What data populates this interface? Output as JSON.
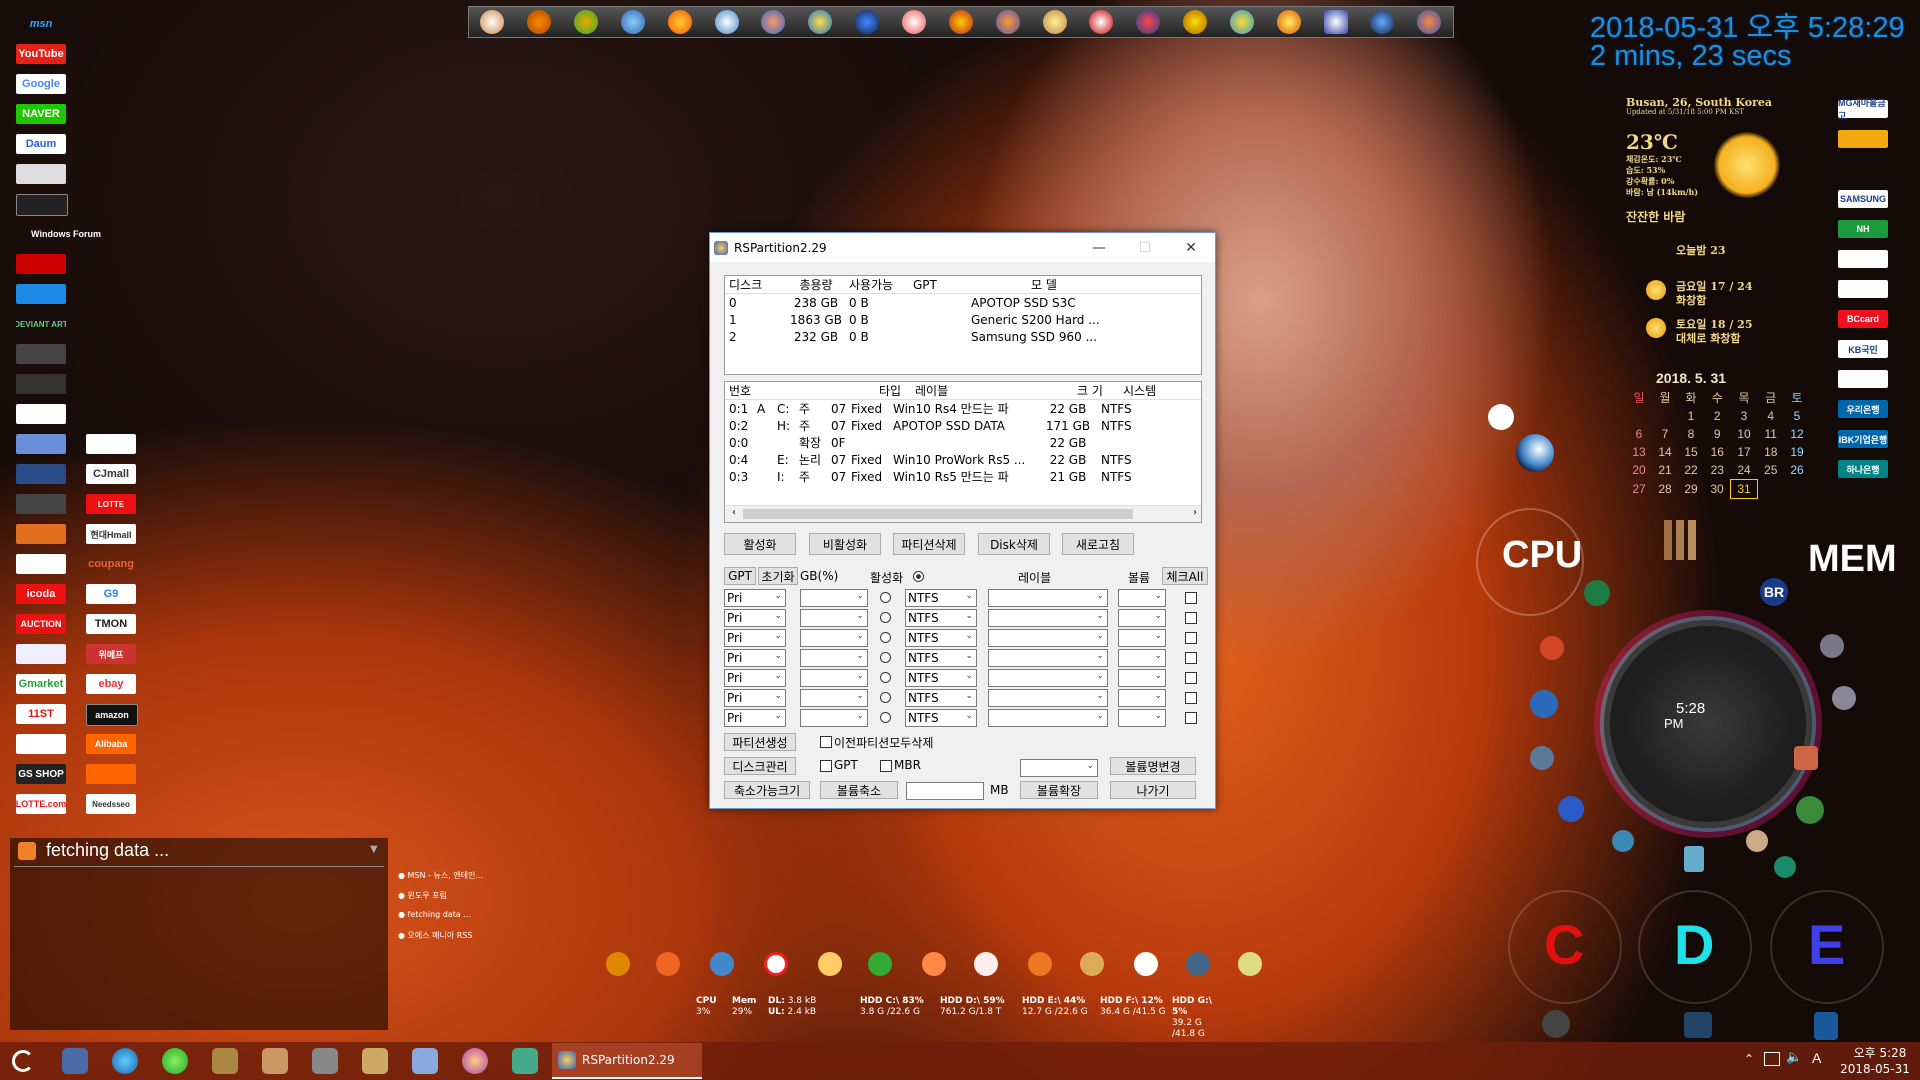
{
  "desktop_left": {
    "col1": [
      "msn",
      "YouTube",
      "Google",
      "NAVER",
      "Daum",
      "",
      "",
      "Windows Forum",
      "",
      "",
      "DEVIANT ART",
      "",
      "",
      "",
      "",
      "",
      "",
      "",
      "",
      "",
      "icoda",
      "AUCTION",
      "",
      "Gmarket",
      "11ST",
      "",
      "GS SHOP",
      "LOTTE.com"
    ],
    "col2": [
      "",
      "CJmall",
      "LOTTE",
      "",
      "현대Hmall",
      "coupang",
      "G9",
      "TMON",
      "위메프",
      "ebay",
      "amazon",
      "Alibaba",
      "",
      "Needsseo"
    ]
  },
  "clock": {
    "datetime": "2018-05-31 오후 5:28:29",
    "uptime": "2 mins, 23 secs"
  },
  "weather": {
    "location": "Busan, 26, South Korea",
    "updated": "Updated at 5/31/18 5:00 PM KST",
    "temp": "23℃",
    "d1": "체감온도: 23℃",
    "d2": "습도: 53%",
    "d3": "강수확률: 0%",
    "d4": "바람: 남 (14km/h)",
    "desc": "잔잔한 바람",
    "today": "오늘밤 23",
    "fri_label": "금요일 17 / 24",
    "fri_desc": "화창함",
    "sat_label": "토요일 18 / 25",
    "sat_desc": "대체로 화창함"
  },
  "banks": [
    "MG새마을금고",
    "",
    "SAMSUNG",
    "NH",
    "",
    "",
    "BCcard",
    "KB국민",
    "",
    "우리은행",
    "IBK기업은행",
    "하나은행"
  ],
  "calendar": {
    "title": "2018. 5. 31",
    "weekdays": [
      "일",
      "월",
      "화",
      "수",
      "목",
      "금",
      "토"
    ],
    "rows": [
      [
        "",
        "",
        "1",
        "2",
        "3",
        "4",
        "5"
      ],
      [
        "6",
        "7",
        "8",
        "9",
        "10",
        "11",
        "12"
      ],
      [
        "13",
        "14",
        "15",
        "16",
        "17",
        "18",
        "19"
      ],
      [
        "20",
        "21",
        "22",
        "23",
        "24",
        "25",
        "26"
      ],
      [
        "27",
        "28",
        "29",
        "30",
        "31",
        "",
        ""
      ]
    ]
  },
  "gadgets": {
    "cpu": "CPU",
    "mem": "MEM",
    "clock_time": "5:28",
    "clock_ampm": "PM",
    "c": "C",
    "d": "D",
    "e": "E",
    "br": "BR"
  },
  "window": {
    "title": "RSPartition2.29",
    "disk_headers": [
      "디스크",
      "총용량",
      "사용가능",
      "GPT",
      "모  델"
    ],
    "disks": [
      [
        "0",
        "238 GB",
        "0 B",
        "",
        "APOTOP SSD S3C"
      ],
      [
        "1",
        "1863 GB",
        "0 B",
        "",
        "Generic S200 Hard ..."
      ],
      [
        "2",
        "232 GB",
        "0 B",
        "",
        "Samsung SSD 960 ..."
      ]
    ],
    "part_headers": [
      "번호",
      "",
      "",
      "",
      "타입",
      "레이블",
      "크 기",
      "시스템"
    ],
    "parts": [
      [
        "0:1",
        "A",
        "C:",
        "주",
        "07",
        "Fixed",
        "Win10 Rs4 만드는 파",
        "22 GB",
        "NTFS"
      ],
      [
        "0:2",
        "",
        "H:",
        "주",
        "07",
        "Fixed",
        "APOTOP SSD DATA",
        "171 GB",
        "NTFS"
      ],
      [
        "0:0",
        "",
        "",
        "확장",
        "0F",
        "",
        "",
        "22 GB",
        ""
      ],
      [
        "0:4",
        "",
        "E:",
        "논리",
        "07",
        "Fixed",
        "Win10 ProWork Rs5 ...",
        "22 GB",
        "NTFS"
      ],
      [
        "0:3",
        "",
        "I:",
        "주",
        "07",
        "Fixed",
        "Win10 Rs5 만드는 파",
        "21 GB",
        "NTFS"
      ]
    ],
    "buttons": {
      "activate": "활성화",
      "deactivate": "비활성화",
      "delete_part": "파티션삭제",
      "delete_disk": "Disk삭제",
      "refresh": "새로고침"
    },
    "form_headers": {
      "gpt": "GPT",
      "init": "초기화",
      "gb": "GB(%)",
      "active": "활성화",
      "label": "레이블",
      "volume": "볼륨",
      "check_all": "체크All"
    },
    "rows": [
      "Pri",
      "Pri",
      "Pri",
      "Pri",
      "Pri",
      "Pri",
      "Pri"
    ],
    "fs": "NTFS",
    "create": "파티션생성",
    "delete_all_prev": "이전파티션모두삭제",
    "disk_mgmt": "디스크관리",
    "gpt": "GPT",
    "mbr": "MBR",
    "rename_vol": "볼륨명변경",
    "shrinkable": "축소가능크기",
    "shrink": "볼륨축소",
    "mb": "MB",
    "extend": "볼륨확장",
    "exit": "나가기"
  },
  "rss": {
    "title": "fetching data ...",
    "items": [
      "MSN - 뉴스, 엔테인...",
      "윈도우 포럼",
      "fetching data ...",
      "오에스 매니아 RSS"
    ]
  },
  "status": {
    "cpu": "CPU",
    "cpu_v": "3%",
    "mem": "Mem",
    "mem_v": "29%",
    "dl": "DL:",
    "dl_v": "3.8 kB",
    "ul": "UL:",
    "ul_v": "2.4 kB",
    "hdd_c": "HDD C:\\  83%",
    "hdd_c_v": "3.8 G  /22.6 G",
    "hdd_d": "HDD D:\\  59%",
    "hdd_d_v": "761.2 G/1.8 T",
    "hdd_e": "HDD E:\\  44%",
    "hdd_e_v": "12.7 G  /22.6 G",
    "hdd_f": "HDD F:\\  12%",
    "hdd_f_v": "36.4 G  /41.5 G",
    "hdd_g": "HDD G:\\  5%",
    "hdd_g_v": "39.2 G  /41.8 G"
  },
  "taskbar": {
    "active_app": "RSPartition2.29",
    "time": "오후 5:28",
    "date": "2018-05-31",
    "ime": "A"
  }
}
